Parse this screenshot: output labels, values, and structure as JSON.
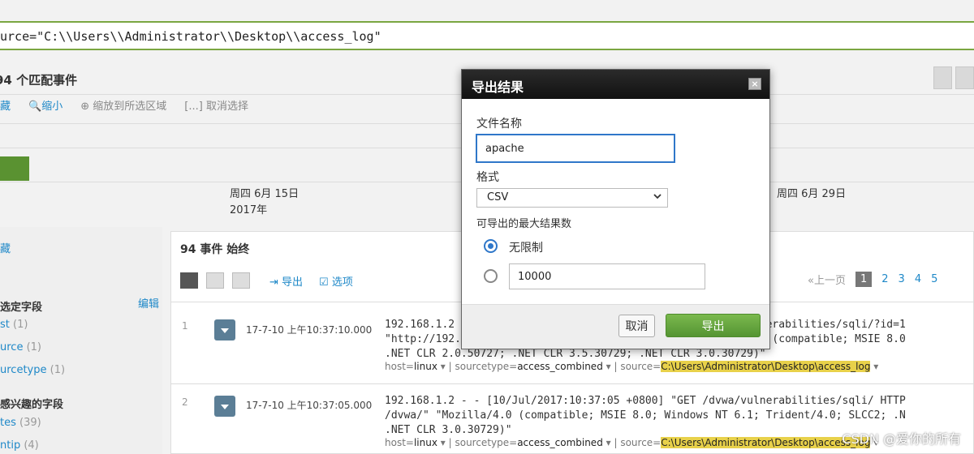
{
  "search": {
    "query": "urce=\"C:\\\\Users\\\\Administrator\\\\Desktop\\\\access_log\""
  },
  "results": {
    "match_title": "94 个匹配事件"
  },
  "timeline": {
    "tool_left": "藏",
    "zoom_out": "缩小",
    "zoom_to_selection": "缩放到所选区域",
    "deselect": "取消选择",
    "date1_line1": "周四 6月 15日",
    "date1_line2": "2017年",
    "date2_line1": "周四 6月 29日"
  },
  "sidebar": {
    "hide": "藏",
    "selected_fields": "选定字段",
    "edit": "编辑",
    "fields": [
      {
        "name": "st",
        "count": "(1)"
      },
      {
        "name": "urce",
        "count": "(1)"
      },
      {
        "name": "urcetype",
        "count": "(1)"
      }
    ],
    "interesting_fields": "感兴趣的字段",
    "interesting": [
      {
        "name": "tes",
        "count": "(39)"
      },
      {
        "name": "ntip",
        "count": "(4)"
      }
    ]
  },
  "events": {
    "header": "94 事件 始终",
    "export": "导出",
    "options": "选项",
    "pager": {
      "prev": "«上一页",
      "pages": [
        "1",
        "2",
        "3",
        "4",
        "5"
      ]
    },
    "rows": [
      {
        "idx": "1",
        "time": "17-7-10 上午10:37:10.000",
        "line1": "192.168.1.2 - - [10/Jul/2017:10:37:10 +0800] \"GET /dvwa/vulnerabilities/sqli/?id=1",
        "line2": "\"http://192.168.1.2/dvwa/vulnerabilities/sqli/\" \"Mozilla/4.0 (compatible; MSIE 8.0",
        "line3": ".NET CLR 2.0.50727; .NET CLR 3.5.30729; .NET CLR 3.0.30729)\"",
        "host": "linux",
        "sourcetype": "access_combined",
        "source": "C:\\Users\\Administrator\\Desktop\\access_log"
      },
      {
        "idx": "2",
        "time": "17-7-10 上午10:37:05.000",
        "line1": "192.168.1.2 - - [10/Jul/2017:10:37:05 +0800] \"GET /dvwa/vulnerabilities/sqli/ HTTP",
        "line2": "/dvwa/\" \"Mozilla/4.0 (compatible; MSIE 8.0; Windows NT 6.1; Trident/4.0; SLCC2; .N",
        "line3": ".NET CLR 3.0.30729)\"",
        "host": "linux",
        "sourcetype": "access_combined",
        "source": "C:\\Users\\Administrator\\Desktop\\access_log"
      }
    ],
    "meta_labels": {
      "host": "host=",
      "sourcetype": "sourcetype=",
      "source": "source="
    }
  },
  "dialog": {
    "title": "导出结果",
    "close": "×",
    "file_name_label": "文件名称",
    "file_name_value": "apache",
    "format_label": "格式",
    "format_value": "CSV",
    "max_label": "可导出的最大结果数",
    "unlimited_label": "无限制",
    "limit_value": "10000",
    "cancel": "取消",
    "export": "导出"
  },
  "watermark": "CSDN @爱你的所有",
  "colors": {
    "accent": "#2f77c9",
    "export_green": "#5e9e3a",
    "dialog_header": "#1a1a1a",
    "highlight": "#e8d14a"
  }
}
